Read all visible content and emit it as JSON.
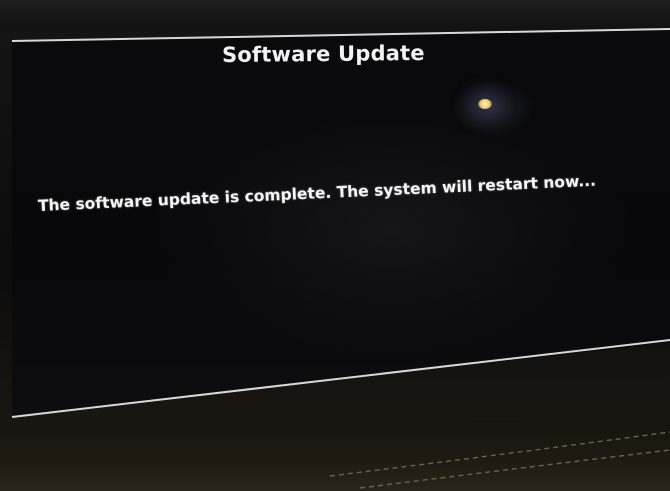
{
  "dialog": {
    "title": "Software Update",
    "message": "The software update is complete. The system will restart now..."
  }
}
